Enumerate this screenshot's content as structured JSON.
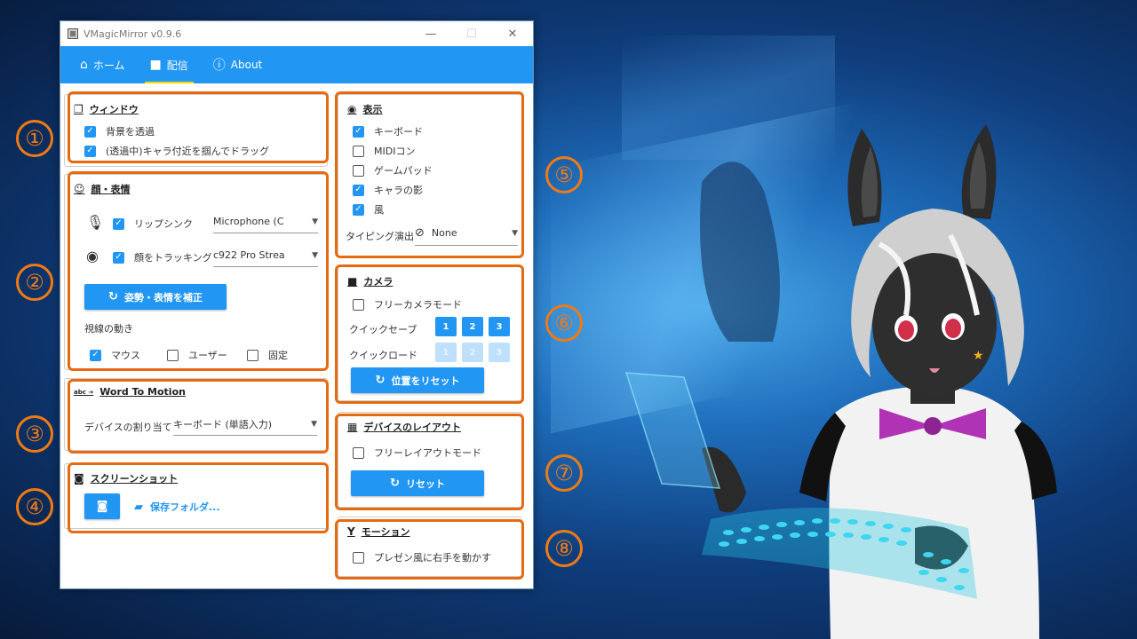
{
  "window": {
    "title": "VMagicMirror v0.9.6",
    "controls": {
      "minimize": "—",
      "maximize": "☐",
      "close": "✕"
    }
  },
  "tabs": [
    {
      "label": "ホーム",
      "icon": "home-icon"
    },
    {
      "label": "配信",
      "icon": "video-camera-icon",
      "active": true
    },
    {
      "label": "About",
      "icon": "help-circle-icon"
    }
  ],
  "window_section": {
    "title": "ウィンドウ",
    "options": [
      {
        "label": "背景を透過",
        "checked": true
      },
      {
        "label": "(透過中)キャラ付近を掴んでドラッグ",
        "checked": true
      }
    ]
  },
  "face_section": {
    "title": "顔・表情",
    "lipsync": {
      "label": "リップシンク",
      "checked": true,
      "device": "Microphone (C"
    },
    "facetracking": {
      "label": "顔をトラッキング",
      "checked": true,
      "device": "c922 Pro Strea"
    },
    "calibrate_button": "姿勢・表情を補正",
    "gaze_label": "視線の動き",
    "gaze_options": [
      {
        "label": "マウス",
        "checked": true
      },
      {
        "label": "ユーザー",
        "checked": false
      },
      {
        "label": "固定",
        "checked": false
      }
    ]
  },
  "word_to_motion": {
    "title": "Word To Motion",
    "icon_text": "abc ➔",
    "device_label": "デバイスの割り当て",
    "device_value": "キーボード (単語入力)"
  },
  "screenshot": {
    "title": "スクリーンショット",
    "folder_label": "保存フォルダ..."
  },
  "display_section": {
    "title": "表示",
    "options": [
      {
        "label": "キーボード",
        "checked": true
      },
      {
        "label": "MIDIコン",
        "checked": false
      },
      {
        "label": "ゲームパッド",
        "checked": false
      },
      {
        "label": "キャラの影",
        "checked": true
      },
      {
        "label": "風",
        "checked": true
      }
    ],
    "typing_label": "タイピング演出",
    "typing_value": "None"
  },
  "camera_section": {
    "title": "カメラ",
    "free_camera": {
      "label": "フリーカメラモード",
      "checked": false
    },
    "quick_save_label": "クイックセーブ",
    "quick_load_label": "クイックロード",
    "slots": [
      "1",
      "2",
      "3"
    ],
    "reset_button": "位置をリセット"
  },
  "device_layout": {
    "title": "デバイスのレイアウト",
    "free_layout": {
      "label": "フリーレイアウトモード",
      "checked": false
    },
    "reset_button": "リセット"
  },
  "motion_section": {
    "title": "モーション",
    "option": {
      "label": "プレゼン風に右手を動かす",
      "checked": false
    }
  },
  "markers": [
    "①",
    "②",
    "③",
    "④",
    "⑤",
    "⑥",
    "⑦",
    "⑧"
  ],
  "colors": {
    "accent": "#2196f3",
    "highlight": "#e86a10",
    "tab_underline": "#ffd600"
  }
}
